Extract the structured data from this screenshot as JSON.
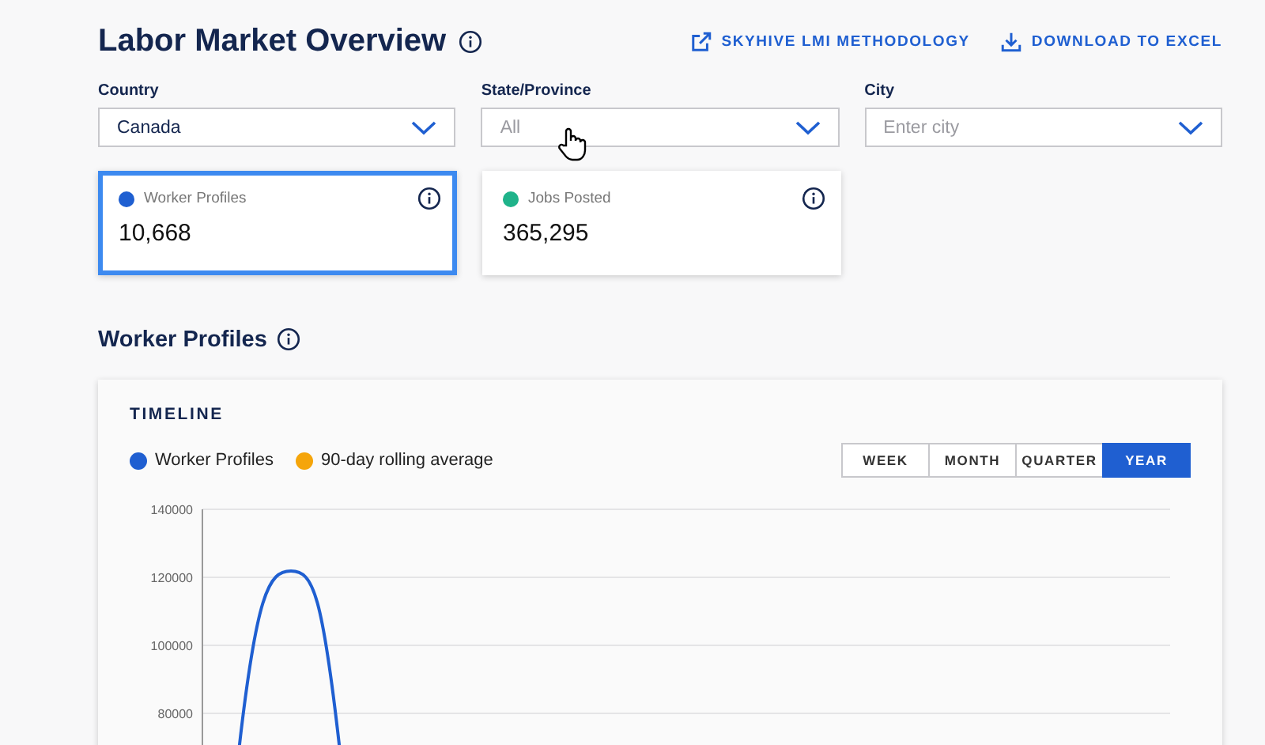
{
  "header": {
    "title": "Labor Market Overview",
    "links": [
      {
        "kind": "external",
        "label": "SKYHIVE LMI METHODOLOGY"
      },
      {
        "kind": "download",
        "label": "DOWNLOAD TO EXCEL"
      }
    ]
  },
  "filters": [
    {
      "label": "Country",
      "value": "Canada"
    },
    {
      "label": "State/Province",
      "placeholder": "All"
    },
    {
      "label": "City",
      "placeholder": "Enter city"
    }
  ],
  "metrics": [
    {
      "label": "Worker Profiles",
      "value": "10,668",
      "color": "#1f5fd1",
      "selected": true
    },
    {
      "label": "Jobs Posted",
      "value": "365,295",
      "color": "#1fb38a",
      "selected": false
    }
  ],
  "section": {
    "title": "Worker Profiles"
  },
  "timeline": {
    "title": "TIMELINE",
    "legend": [
      {
        "label": "Worker Profiles",
        "color": "#1f5fd1"
      },
      {
        "label": "90-day rolling average",
        "color": "#f5a50a"
      }
    ],
    "periods": [
      {
        "label": "WEEK",
        "selected": false
      },
      {
        "label": "MONTH",
        "selected": false
      },
      {
        "label": "QUARTER",
        "selected": false
      },
      {
        "label": "YEAR",
        "selected": true
      }
    ],
    "y_ticks": [
      "140000",
      "120000",
      "100000",
      "80000"
    ]
  }
}
